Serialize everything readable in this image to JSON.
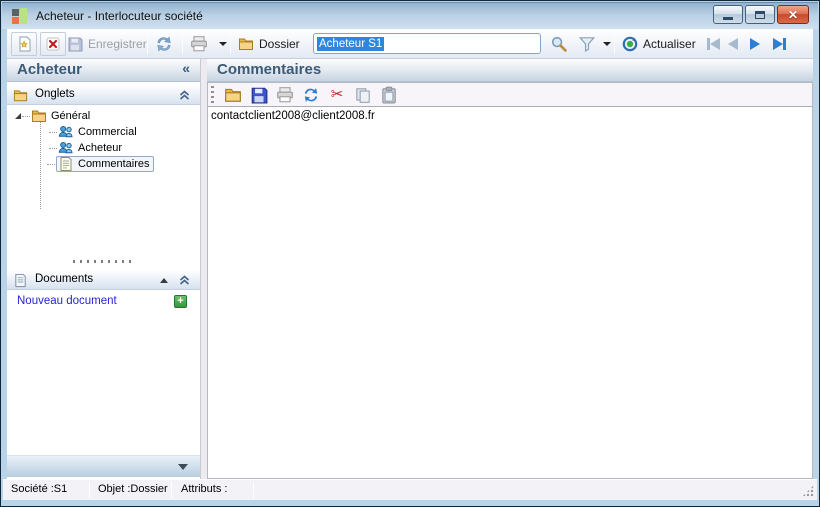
{
  "window": {
    "title": "Acheteur -  Interlocuteur société",
    "titlebar_color": "#b9d0e4",
    "close_glyph": "✕"
  },
  "toolbar": {
    "save_label": "Enregistrer",
    "dossier_label": "Dossier",
    "search_value": "Acheteur S1",
    "actualiser_label": "Actualiser",
    "selection_color": "#2f86dd"
  },
  "sidebar": {
    "title": "Acheteur",
    "collapse_glyph": "«",
    "onglets": {
      "label": "Onglets",
      "tree": {
        "root": {
          "label": "Général",
          "icon": "folder-icon",
          "expanded": true
        },
        "children": [
          {
            "label": "Commercial",
            "icon": "people-icon",
            "selected": false
          },
          {
            "label": "Acheteur",
            "icon": "people-icon",
            "selected": false
          },
          {
            "label": "Commentaires",
            "icon": "note-icon",
            "selected": true
          }
        ]
      }
    },
    "documents": {
      "label": "Documents",
      "new_document_label": "Nouveau document",
      "add_glyph": "+",
      "link_color": "#2525d6",
      "add_button_color": "#2f9a3b"
    }
  },
  "main": {
    "title": "Commentaires",
    "toolbar_icons": [
      "folder-icon",
      "save-icon",
      "print-icon",
      "refresh-icon",
      "cut-icon",
      "copy-icon",
      "paste-icon"
    ],
    "cut_glyph": "✂",
    "comment_text": "contactclient2008@client2008.fr"
  },
  "statusbar": {
    "segments": [
      "Société :S1",
      "Objet :Dossier",
      "Attributs :"
    ]
  }
}
